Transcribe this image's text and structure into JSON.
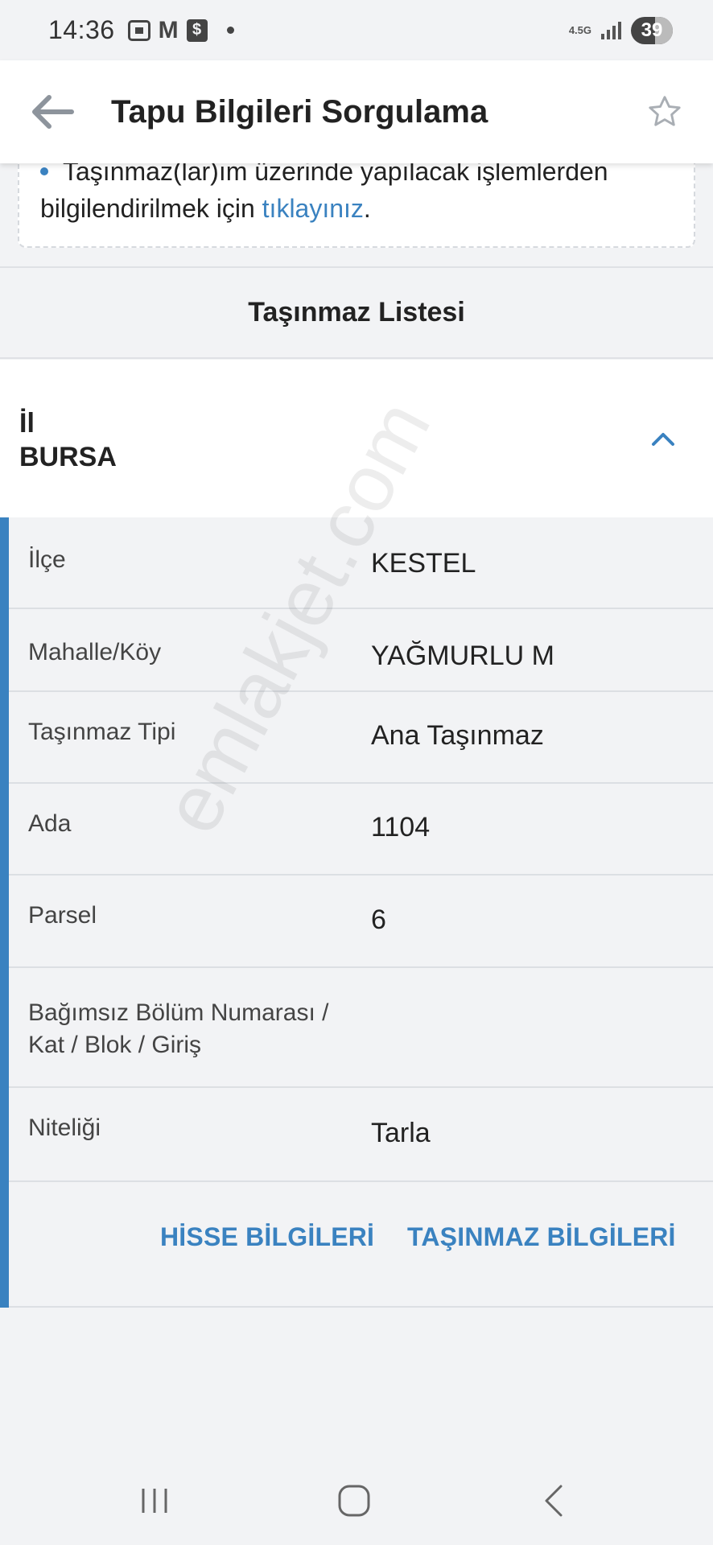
{
  "status_bar": {
    "time": "14:36",
    "network": "4.5G",
    "battery": "39",
    "icons": [
      "screenshot-icon",
      "gmail-icon",
      "dollar-app-icon",
      "notification-dot-icon"
    ]
  },
  "header": {
    "title": "Tapu Bilgileri Sorgulama",
    "back_icon": "arrow-left-icon",
    "favorite_icon": "star-outline-icon"
  },
  "info": {
    "line1": "Taşınmaz(lar)ım üzerinde yapılacak işlemlerden",
    "line2_prefix": "bilgilendirilmek için ",
    "link": "tıklayınız",
    "line2_suffix": "."
  },
  "section": {
    "title": "Taşınmaz Listesi"
  },
  "il": {
    "label": "İl",
    "value": "BURSA"
  },
  "details": {
    "ilce": {
      "label": "İlçe",
      "value": "KESTEL"
    },
    "mahalle": {
      "label": "Mahalle/Köy",
      "value": "YAĞMURLU M"
    },
    "tip": {
      "label": "Taşınmaz Tipi",
      "value": "Ana Taşınmaz"
    },
    "ada": {
      "label": "Ada",
      "value": "1104"
    },
    "parsel": {
      "label": "Parsel",
      "value": "6"
    },
    "bagimsiz": {
      "label_line1": "Bağımsız Bölüm Numarası /",
      "label_line2": "Kat / Blok / Giriş",
      "value": ""
    },
    "nitelik": {
      "label": "Niteliği",
      "value": "Tarla"
    }
  },
  "actions": {
    "hisse": "HİSSE BİLGİLERİ",
    "tasinmaz": "TAŞINMAZ BİLGİLERİ"
  },
  "watermark": "emlakjet.com",
  "colors": {
    "accent": "#3a82c0",
    "background": "#f2f3f5",
    "card": "#ffffff"
  }
}
